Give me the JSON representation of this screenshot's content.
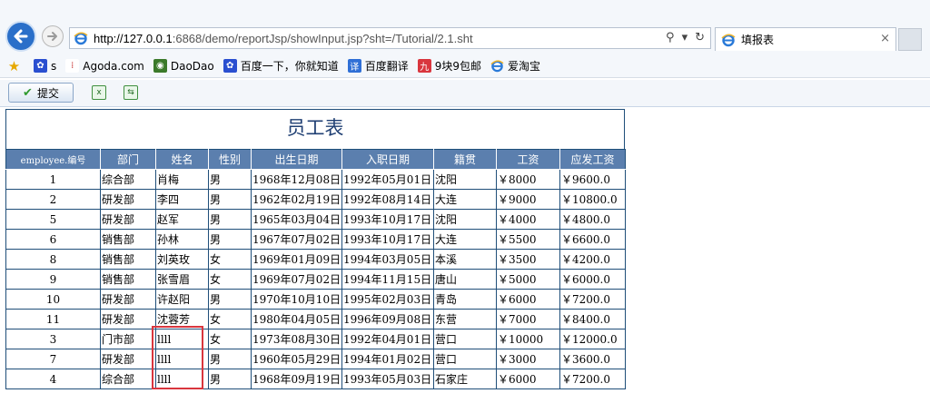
{
  "browser": {
    "url_host": "http://127.0.0.1",
    "url_rest": ":6868/demo/reportJsp/showInput.jsp?sht=/Tutorial/2.1.sht",
    "tab_title": "填报表",
    "tab_close": "×",
    "favorites": [
      {
        "label": "s",
        "icon": "paw-icon",
        "color": "#2a4fd0"
      },
      {
        "label": "Agoda.com",
        "icon": "agoda-icon",
        "color": "#c93838"
      },
      {
        "label": "DaoDao",
        "icon": "owl-icon",
        "color": "#3b7a2a"
      },
      {
        "label": "百度一下，你就知道",
        "icon": "paw-icon",
        "color": "#2a4fd0"
      },
      {
        "label": "百度翻译",
        "icon": "translate-icon",
        "color": "#2f6fd6"
      },
      {
        "label": "9块9包邮",
        "icon": "nine-icon",
        "color": "#d9363e"
      },
      {
        "label": "爱淘宝",
        "icon": "ie-icon",
        "color": "#f0b429"
      }
    ]
  },
  "toolbar": {
    "submit_label": "提交"
  },
  "report": {
    "title": "员工表",
    "columns": [
      "employee.编号",
      "部门",
      "姓名",
      "性别",
      "出生日期",
      "入职日期",
      "籍贯",
      "工资",
      "应发工资"
    ],
    "rows": [
      [
        "1",
        "综合部",
        "肖梅",
        "男",
        "1968年12月08日",
        "1992年05月01日",
        "沈阳",
        "￥8000",
        "￥9600.0"
      ],
      [
        "2",
        "研发部",
        "李四",
        "男",
        "1962年02月19日",
        "1992年08月14日",
        "大连",
        "￥9000",
        "￥10800.0"
      ],
      [
        "5",
        "研发部",
        "赵军",
        "男",
        "1965年03月04日",
        "1993年10月17日",
        "沈阳",
        "￥4000",
        "￥4800.0"
      ],
      [
        "6",
        "销售部",
        "孙林",
        "男",
        "1967年07月02日",
        "1993年10月17日",
        "大连",
        "￥5500",
        "￥6600.0"
      ],
      [
        "8",
        "销售部",
        "刘英玫",
        "女",
        "1969年01月09日",
        "1994年03月05日",
        "本溪",
        "￥3500",
        "￥4200.0"
      ],
      [
        "9",
        "销售部",
        "张雪眉",
        "女",
        "1969年07月02日",
        "1994年11月15日",
        "唐山",
        "￥5000",
        "￥6000.0"
      ],
      [
        "10",
        "研发部",
        "许赵阳",
        "男",
        "1970年10月10日",
        "1995年02月03日",
        "青岛",
        "￥6000",
        "￥7200.0"
      ],
      [
        "11",
        "研发部",
        "沈蓉芳",
        "女",
        "1980年04月05日",
        "1996年09月08日",
        "东营",
        "￥7000",
        "￥8400.0"
      ],
      [
        "3",
        "门市部",
        "llll",
        "女",
        "1973年08月30日",
        "1992年04月01日",
        "营口",
        "￥10000",
        "￥12000.0"
      ],
      [
        "7",
        "研发部",
        "llll",
        "男",
        "1960年05月29日",
        "1994年01月02日",
        "营口",
        "￥3000",
        "￥3600.0"
      ],
      [
        "4",
        "综合部",
        "llll",
        "男",
        "1968年09月19日",
        "1993年05月03日",
        "石家庄",
        "￥6000",
        "￥7200.0"
      ]
    ]
  },
  "colors": {
    "header_bg": "#5b7fae",
    "border": "#1f4e79",
    "highlight": "#d9363e"
  }
}
